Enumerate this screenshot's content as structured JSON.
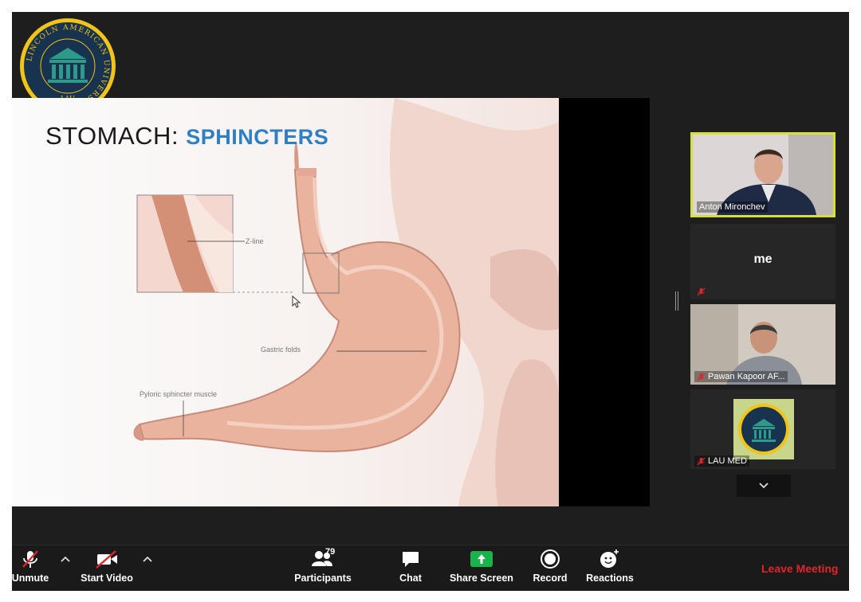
{
  "logo": {
    "ring_text": "LINCOLN AMERICAN UNIVERSITY",
    "abbr": "LAU"
  },
  "slide": {
    "title_main": "STOMACH:",
    "title_accent": "SPHINCTERS",
    "labels": {
      "z_line": "Z-line",
      "gastric_folds": "Gastric folds",
      "pyloric": "Pyloric sphincter muscle"
    }
  },
  "participants_panel": {
    "tiles": [
      {
        "name": "Anton Mironchev",
        "muted": false,
        "active": true
      },
      {
        "name": "me",
        "muted": true,
        "active": false
      },
      {
        "name": "Pawan Kapoor AF...",
        "muted": true,
        "active": false
      },
      {
        "name": "LAU MED",
        "muted": true,
        "active": false
      }
    ]
  },
  "toolbar": {
    "unmute": "Unmute",
    "start_video": "Start Video",
    "participants": "Participants",
    "participants_count": "79",
    "chat": "Chat",
    "share_screen": "Share Screen",
    "record": "Record",
    "reactions": "Reactions",
    "leave": "Leave Meeting"
  },
  "colors": {
    "accent_blue": "#2f7fc4",
    "leave_red": "#e0252b",
    "share_green": "#19b24b",
    "active_speaker_border": "#d4e13c",
    "logo_gold": "#f2c318",
    "logo_navy": "#18334f",
    "logo_teal": "#2e9a8a"
  },
  "icons": {
    "unmute": "mic-muted-icon",
    "video": "camera-off-icon",
    "participants": "people-icon",
    "chat": "chat-bubble-icon",
    "share": "share-arrow-icon",
    "record": "record-icon",
    "reactions": "emoji-plus-icon"
  }
}
